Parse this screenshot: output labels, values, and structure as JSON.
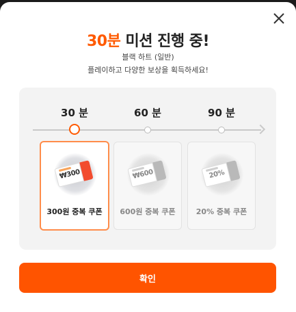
{
  "modal": {
    "title_accent": "30분",
    "title_rest": " 미션 진행 중!",
    "subtitle": "블랙 하트 (일반)",
    "description": "플레이하고 다양한 보상을 획득하세요!",
    "close_icon": "close-icon",
    "accent_color": "#ff5a00"
  },
  "mission": {
    "times": [
      "30 분",
      "60 분",
      "90 분"
    ],
    "active_index": 0,
    "rewards": [
      {
        "ticket_value": "₩300",
        "label": "300원 중복 쿠폰",
        "active": true
      },
      {
        "ticket_value": "₩600",
        "label": "600원 중복 쿠폰",
        "active": false
      },
      {
        "ticket_value": "20%",
        "label": "20% 중복 쿠폰",
        "active": false
      }
    ]
  },
  "footer": {
    "confirm_label": "확인",
    "button_color": "#ff5400"
  }
}
